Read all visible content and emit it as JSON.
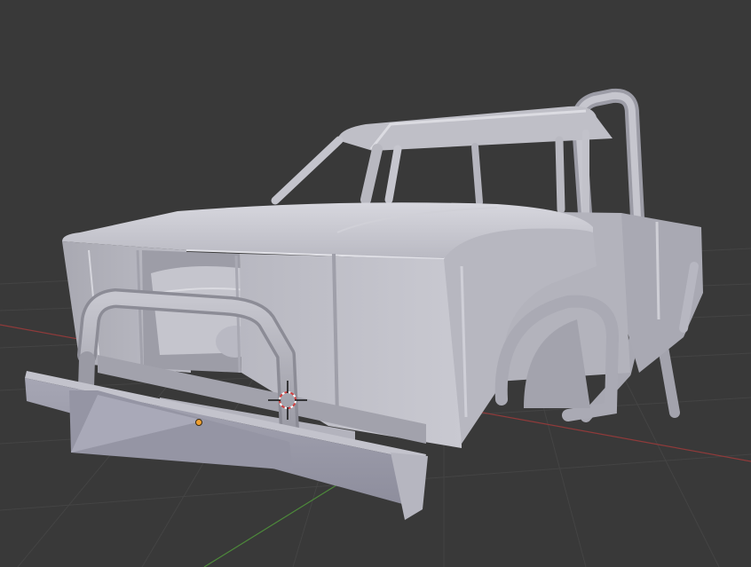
{
  "viewport": {
    "background": "#393939",
    "grid_color": "#444444",
    "x_axis_color": "#8f3a3a",
    "y_axis_color": "#4d8a3a"
  },
  "scene": {
    "object": "truck-body-mesh",
    "material_color": "#c7c7cf",
    "cursor": "3d-cursor-icon",
    "origin": "object-origin-icon",
    "origin_color": "#f0a030"
  }
}
